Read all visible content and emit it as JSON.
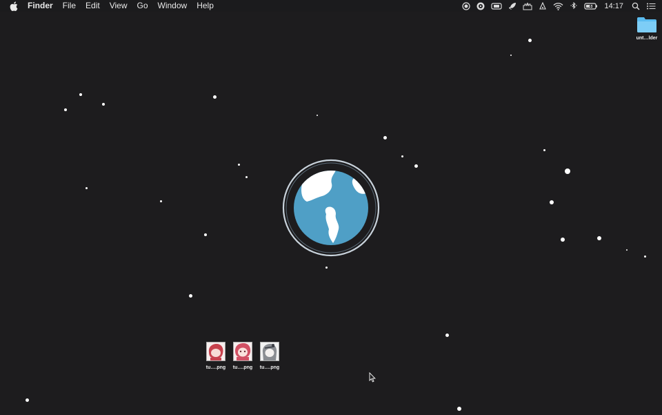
{
  "menubar": {
    "app_name": "Finder",
    "items": [
      "File",
      "Edit",
      "View",
      "Go",
      "Window",
      "Help"
    ],
    "clock": "14:17"
  },
  "desktop": {
    "folder": {
      "label": "unt…lder",
      "color": "#5bbcf0"
    },
    "files": [
      {
        "label": "tu….png"
      },
      {
        "label": "tu….png"
      },
      {
        "label": "tu….png"
      }
    ]
  },
  "colors": {
    "background": "#1d1c1e",
    "globe_ocean": "#4f9fc6",
    "globe_land": "#ffffff"
  }
}
